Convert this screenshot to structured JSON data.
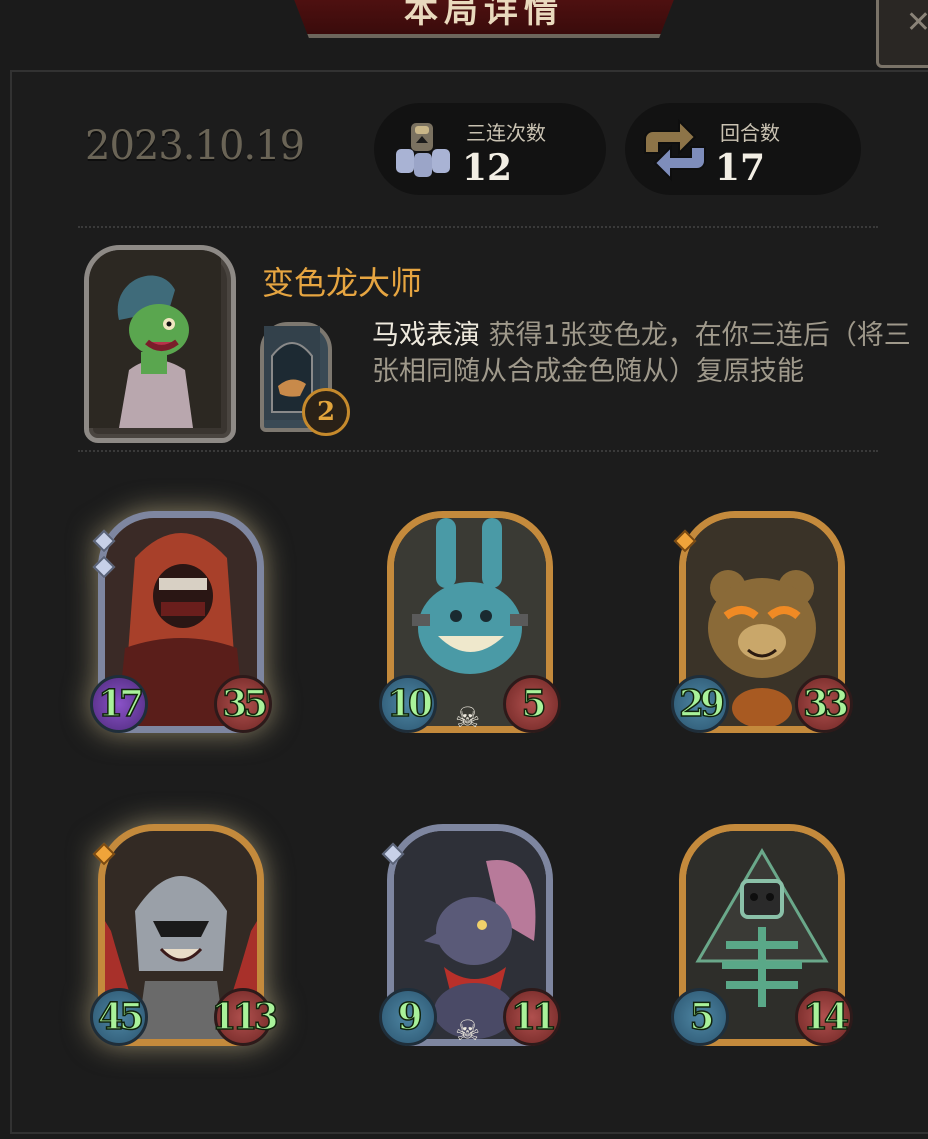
{
  "header": {
    "title": "本局详情"
  },
  "match": {
    "date": "2023.10.19",
    "triples": {
      "label": "三连次数",
      "value": "12"
    },
    "rounds": {
      "label": "回合数",
      "value": "17"
    }
  },
  "hero": {
    "name": "变色龙大师",
    "skill_name": "马戏表演",
    "skill_desc": " 获得1张变色龙，在你三连后（将三张相同随从合成金色随从）复原技能",
    "skill_count": "2"
  },
  "cards": [
    {
      "attack": "17",
      "health": "35",
      "frame": "silver",
      "glow": true,
      "skull": false,
      "atk_style": "purple",
      "gems": 2,
      "art": "hooded-assassin"
    },
    {
      "attack": "10",
      "health": "5",
      "frame": "gold",
      "glow": false,
      "skull": true,
      "atk_style": "blue",
      "gems": 0,
      "art": "patchwork-rabbit"
    },
    {
      "attack": "29",
      "health": "33",
      "frame": "gold",
      "glow": false,
      "skull": false,
      "atk_style": "blue",
      "gems": 1,
      "art": "teddy-bear"
    },
    {
      "attack": "45",
      "health": "113",
      "frame": "gold",
      "glow": true,
      "skull": false,
      "atk_style": "blue",
      "gems": 1,
      "art": "helmet-warrior"
    },
    {
      "attack": "9",
      "health": "11",
      "frame": "silver",
      "glow": false,
      "skull": true,
      "atk_style": "blue",
      "gems": 1,
      "art": "grey-rat"
    },
    {
      "attack": "5",
      "health": "14",
      "frame": "gold",
      "glow": false,
      "skull": false,
      "atk_style": "blue",
      "gems": 0,
      "art": "skeleton-wraith"
    }
  ],
  "colors": {
    "background": "#1b1b1b",
    "hero_name": "#e6a541",
    "stat_text": "#a9f29a",
    "gold_frame": "#c48a3c",
    "silver_frame": "#7e86a0"
  }
}
